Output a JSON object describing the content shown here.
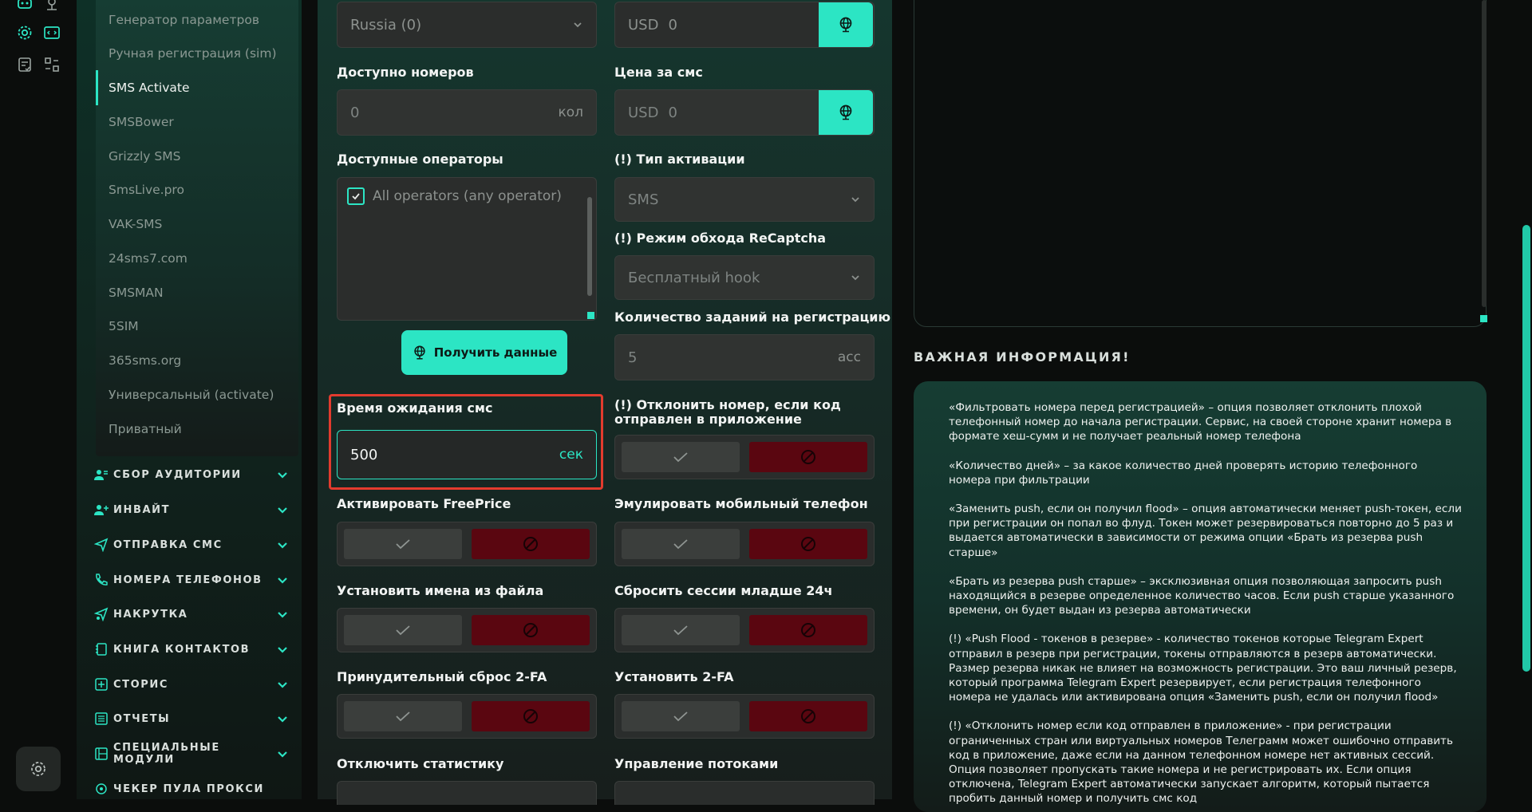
{
  "submenu": {
    "items": [
      {
        "label": "Генератор параметров"
      },
      {
        "label": "Ручная регистрация (sim)"
      },
      {
        "label": "SMS Activate"
      },
      {
        "label": "SMSBower"
      },
      {
        "label": "Grizzly SMS"
      },
      {
        "label": "SmsLive.pro"
      },
      {
        "label": "VAK-SMS"
      },
      {
        "label": "24sms7.com"
      },
      {
        "label": "SMSMAN"
      },
      {
        "label": "5SIM"
      },
      {
        "label": "365sms.org"
      },
      {
        "label": "Универсальный (activate)"
      },
      {
        "label": "Приватный"
      }
    ],
    "active_index": 2
  },
  "sections": [
    {
      "label": "СБОР АУДИТОРИИ",
      "icon": "users-icon"
    },
    {
      "label": "ИНВАЙТ",
      "icon": "user-add-icon"
    },
    {
      "label": "ОТПРАВКА СМС",
      "icon": "send-icon"
    },
    {
      "label": "НОМЕРА ТЕЛЕФОНОВ",
      "icon": "phone-icon"
    },
    {
      "label": "НАКРУТКА",
      "icon": "send-boost-icon"
    },
    {
      "label": "КНИГА КОНТАКТОВ",
      "icon": "contacts-book-icon"
    },
    {
      "label": "СТОРИС",
      "icon": "plus-square-icon"
    },
    {
      "label": "ОТЧЕТЫ",
      "icon": "report-icon"
    },
    {
      "label": "СПЕЦИАЛЬНЫЕ МОДУЛИ",
      "icon": "modules-icon"
    },
    {
      "label": "ЧЕКЕР ПУЛА ПРОКСИ",
      "icon": "proxy-icon"
    }
  ],
  "form": {
    "country": {
      "value": "Russia (0)"
    },
    "balance": {
      "currency": "USD",
      "value": "0"
    },
    "available_numbers": {
      "label": "Доступно номеров",
      "value": "0",
      "suffix": "кол"
    },
    "sms_price": {
      "label": "Цена за смс",
      "currency": "USD",
      "value": "0"
    },
    "operators": {
      "label": "Доступные операторы",
      "option": "All operators (any operator)",
      "checked": true
    },
    "activation_type": {
      "label": "(!) Тип активации",
      "value": "SMS"
    },
    "get_data_button": "Получить данные",
    "recaptcha_mode": {
      "label": "(!) Режим обхода ReCaptcha",
      "value": "Бесплатный hook"
    },
    "tasks_count": {
      "label": "Количество заданий на регистрацию",
      "value": "5",
      "suffix": "acc"
    },
    "sms_wait_time": {
      "label": "Время ожидания смс",
      "value": "500",
      "suffix": "сек"
    },
    "reject_if_app_code": {
      "label": "(!) Отклонить номер, если код отправлен в приложение"
    },
    "freeprice": {
      "label": "Активировать FreePrice"
    },
    "emulate_mobile": {
      "label": "Эмулировать мобильный телефон"
    },
    "names_from_file": {
      "label": "Установить имена из файла"
    },
    "reset_sessions": {
      "label": "Сбросить сессии младше 24ч"
    },
    "force_reset_2fa": {
      "label": "Принудительный сброс 2-FA"
    },
    "set_2fa": {
      "label": "Установить 2-FA"
    },
    "disable_stats": {
      "label": "Отключить статистику"
    },
    "threads": {
      "label": "Управление потоками"
    }
  },
  "info": {
    "title": "ВАЖНАЯ ИНФОРМАЦИЯ!",
    "paragraphs": [
      "«Фильтровать номера перед регистрацией» – опция позволяет отклонить плохой телефонный номер до начала регистрации. Сервис, на своей стороне хранит номера в формате хеш-сумм и не получает реальный номер телефона",
      "«Количество дней» – за какое количество дней проверять историю телефонного номера при фильтрации",
      "«Заменить push, если он получил flood» – опция автоматически меняет push-токен, если при регистрации он попал во флуд. Токен может резервироваться повторно до 5 раз и выдается автоматически в зависимости от режима опции «Брать из резерва push старше»",
      "«Брать из резерва push старше» – эксклюзивная опция позволяющая запросить push находящийся в резерве определенное количество часов. Если push старше указанного времени, он будет выдан из резерва автоматически",
      "(!) «Push Flood - токенов в резерве» - количество токенов которые Telegram Expert отправил в резерв при регистрации, токены отправляются в резерв автоматически. Размер резерва никак не влияет на возможность регистрации. Это ваш личный резерв, который программа Telegram Expert резервирует, если регистрация телефонного номера не удалась или активирована опция «Заменить push, если он получил flood»",
      "(!) «Отклонить номер если код отправлен в приложение» - при регистрации ограниченных стран или виртуальных номеров Телеграмм может ошибочно отправить код в приложение, даже если на данном телефонном номере нет активных сессий. Опция позволяет пропускать такие номера и не регистрировать их. Если опция отключена, Telegram Expert автоматически запускает алгоритм, который пытается пробить данный номер и получить смс код"
    ]
  },
  "colors": {
    "accent": "#2ce5c4",
    "danger": "#5a0610",
    "highlight_border": "#e23b2e"
  }
}
